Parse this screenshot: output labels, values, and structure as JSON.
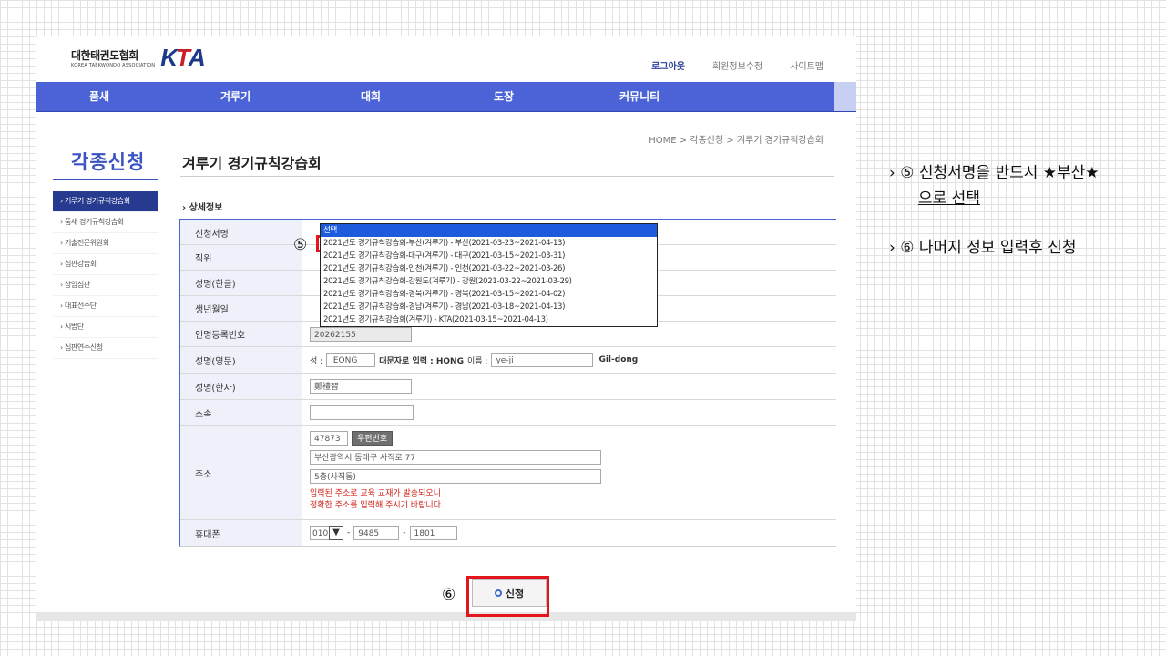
{
  "header": {
    "logo_ko": "대한태권도협회",
    "logo_en": "KOREA TAEKWONDO ASSOCIATION",
    "logo_mark": "KTA",
    "links": [
      "로그아웃",
      "회원정보수정",
      "사이트맵"
    ]
  },
  "nav": [
    "품새",
    "겨루기",
    "대회",
    "도장",
    "커뮤니티"
  ],
  "sidebar": {
    "title": "각종신청",
    "items": [
      "거루기 경기규칙강습회",
      "품새 경기규칙강습회",
      "기술전문위원회",
      "심판강습회",
      "상임심판",
      "대표선수단",
      "시범단",
      "심판연수신청"
    ]
  },
  "breadcrumb": "HOME > 각종신청 > 겨루기 경기규칙강습회",
  "page_title": "겨루기 경기규칙강습회",
  "section_title": "› 상세정보",
  "form": {
    "labels": [
      "신청서명",
      "직위",
      "성명(한글)",
      "생년월일",
      "인명등록번호",
      "성명(영문)",
      "성명(한자)",
      "소속",
      "주소",
      "휴대폰"
    ],
    "reg_number": "20262155",
    "eng_surname_prefix": "성 :",
    "eng_surname": "JEONG",
    "eng_uppercase_note": "대문자로 입력 : HONG",
    "eng_given_prefix": "이름 :",
    "eng_given": "ye-ji",
    "eng_example": "Gil-dong",
    "hanja_name": "鄭禮智",
    "postcode": "47873",
    "postcode_button": "우편번호",
    "address1": "부산광역시 동래구 사직로 77",
    "address2": "5층(사직동)",
    "notice_line1": "입력된 주소로 교육 교재가 발송되오니",
    "notice_line2": "정확한 주소를 입력해 주시기 바랍니다.",
    "phone_prefix": "010",
    "phone_arrow": "▼",
    "phone_sep": "-",
    "phone_mid": "9485",
    "phone_last": "1801"
  },
  "dropdown": {
    "options": [
      "선택",
      "2021년도 경기규칙강습회-부산(겨루기) - 부산(2021-03-23~2021-04-13)",
      "2021년도 경기규칙강습회-대구(겨루기) - 대구(2021-03-15~2021-03-31)",
      "2021년도 경기규칙강습회-인천(겨루기) - 인천(2021-03-22~2021-03-26)",
      "2021년도 경기규칙강습회-강원도(겨루기) - 강원(2021-03-22~2021-03-29)",
      "2021년도 경기규칙강습회-경북(겨루기) - 경북(2021-03-15~2021-04-02)",
      "2021년도 경기규칙강습회-경남(겨루기) - 경남(2021-03-18~2021-04-13)",
      "2021년도 경기규칙강습회(겨루기) - KTA(2021-03-15~2021-04-13)"
    ],
    "selected_index": 0
  },
  "markers": {
    "five": "⑤",
    "six": "⑥"
  },
  "submit_label": "신청",
  "notes": {
    "note1_prefix": "› ⑤ ",
    "note1_line1": "신청서명을 반드시 ★부산★",
    "note1_line2": "으로 선택",
    "note2": "› ⑥ 나머지 정보 입력후 신청"
  },
  "colors": {
    "nav": "#4b63d6",
    "accent": "#3b53c2",
    "highlight": "#e2141c",
    "selected": "#1e5adc"
  }
}
